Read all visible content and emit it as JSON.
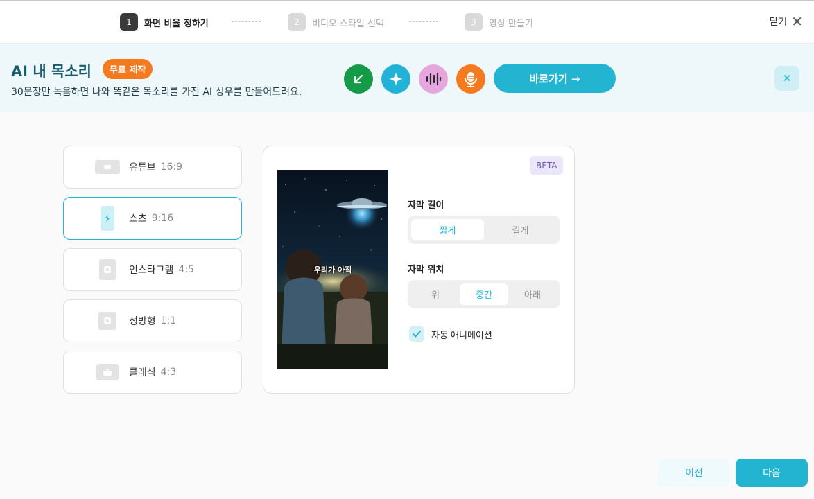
{
  "stepper": {
    "steps": [
      {
        "number": "1",
        "label": "화면 비율 정하기"
      },
      {
        "number": "2",
        "label": "비디오 스타일 선택"
      },
      {
        "number": "3",
        "label": "영상 만들기"
      }
    ],
    "active_step": 1,
    "close_label": "닫기"
  },
  "banner": {
    "title": "AI 내 목소리",
    "badge": "무료 제작",
    "subtitle": "30문장만 녹음하면 나와 똑같은 목소리를 가진 AI 성우를 만들어드려요.",
    "icons": [
      {
        "name": "arrow-down-left-icon",
        "color": "#159a48"
      },
      {
        "name": "sparkle-icon",
        "color": "#22b2d6"
      },
      {
        "name": "waveform-icon",
        "color": "#e6a6dd"
      },
      {
        "name": "microphone-icon",
        "color": "#f47a1f"
      }
    ],
    "cta_label": "바로가기 →"
  },
  "ratios": [
    {
      "name": "유튜브",
      "value": "16:9",
      "selected": false
    },
    {
      "name": "쇼츠",
      "value": "9:16",
      "selected": true
    },
    {
      "name": "인스타그램",
      "value": "4:5",
      "selected": false
    },
    {
      "name": "정방형",
      "value": "1:1",
      "selected": false
    },
    {
      "name": "클래식",
      "value": "4:3",
      "selected": false
    }
  ],
  "preview": {
    "beta_label": "BETA",
    "caption": "우리가 아직",
    "subtitle_length": {
      "label": "자막 길이",
      "options": [
        "짧게",
        "길게"
      ],
      "selected": "짧게"
    },
    "subtitle_position": {
      "label": "자막 위치",
      "options": [
        "위",
        "중간",
        "아래"
      ],
      "selected": "중간"
    },
    "auto_animation": {
      "label": "자동 애니메이션",
      "checked": true
    }
  },
  "footer": {
    "prev_label": "이전",
    "next_label": "다음"
  },
  "colors": {
    "accent": "#23b4d2",
    "badge": "#f47a1f",
    "banner_bg": "#eef8fa"
  }
}
